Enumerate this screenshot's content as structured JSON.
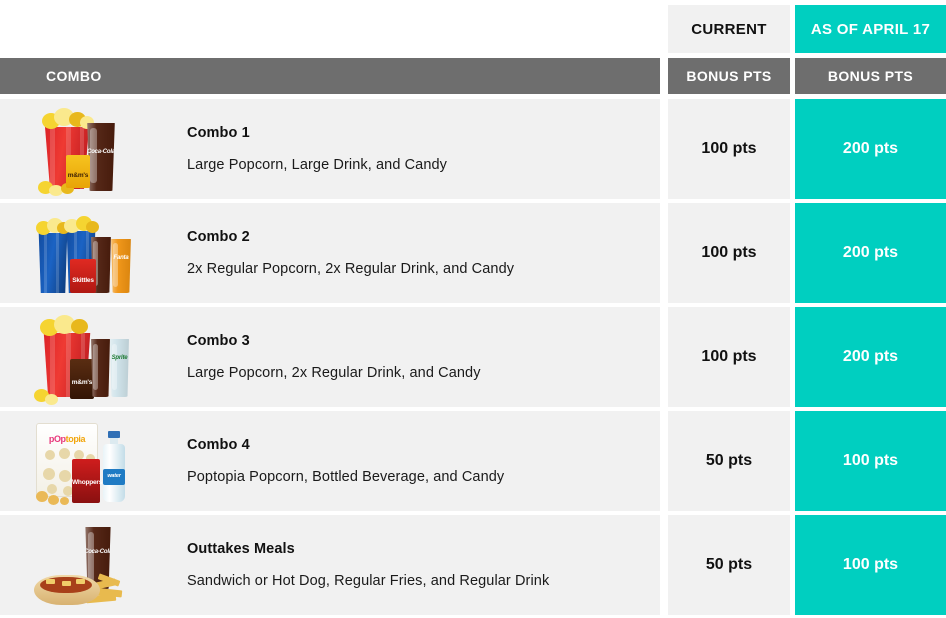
{
  "table": {
    "headers": {
      "combo_col": "COMBO",
      "current_top": "CURRENT",
      "promo_top": "AS OF APRIL 17",
      "current_sub": "BONUS PTS",
      "promo_sub": "BONUS PTS"
    },
    "colors": {
      "promo_accent": "#00CFC0",
      "header_gray": "#6E6E6E",
      "row_background": "#F1F1F1",
      "page_background": "#FFFFFF",
      "text_dark": "#111111"
    },
    "rows": [
      {
        "name": "Combo 1",
        "description": "Large Popcorn, Large Drink, and Candy",
        "current_points": "100 pts",
        "promo_points": "200 pts",
        "image_alt": "large-red-popcorn-tub-coca-cola-cup-and-mms-candy"
      },
      {
        "name": "Combo 2",
        "description": "2x Regular Popcorn, 2x Regular Drink, and Candy",
        "current_points": "100 pts",
        "promo_points": "200 pts",
        "image_alt": "two-blue-popcorn-bags-cola-and-fanta-cups-and-skittles-candy"
      },
      {
        "name": "Combo 3",
        "description": "Large Popcorn, 2x Regular Drink, and Candy",
        "current_points": "100 pts",
        "promo_points": "200 pts",
        "image_alt": "large-red-popcorn-bag-mms-candy-cola-and-sprite-cups"
      },
      {
        "name": "Combo 4",
        "description": "Poptopia Popcorn, Bottled Beverage, and Candy",
        "current_points": "50 pts",
        "promo_points": "100 pts",
        "image_alt": "poptopia-popcorn-bag-whoppers-candy-and-bottled-water"
      },
      {
        "name": "Outtakes Meals",
        "description": "Sandwich or Hot Dog, Regular Fries, and Regular Drink",
        "current_points": "50 pts",
        "promo_points": "100 pts",
        "image_alt": "chili-hot-dog-with-fries-and-coca-cola-cup"
      }
    ],
    "labels": {
      "coke": "Coca-Cola",
      "fanta": "Fanta",
      "sprite": "Sprite",
      "mms": "m&m's",
      "skittles": "Skittles",
      "whoppers": "Whoppers",
      "poptopia_pop": "pOp",
      "poptopia_topia": "topia",
      "dasani": "water"
    }
  }
}
